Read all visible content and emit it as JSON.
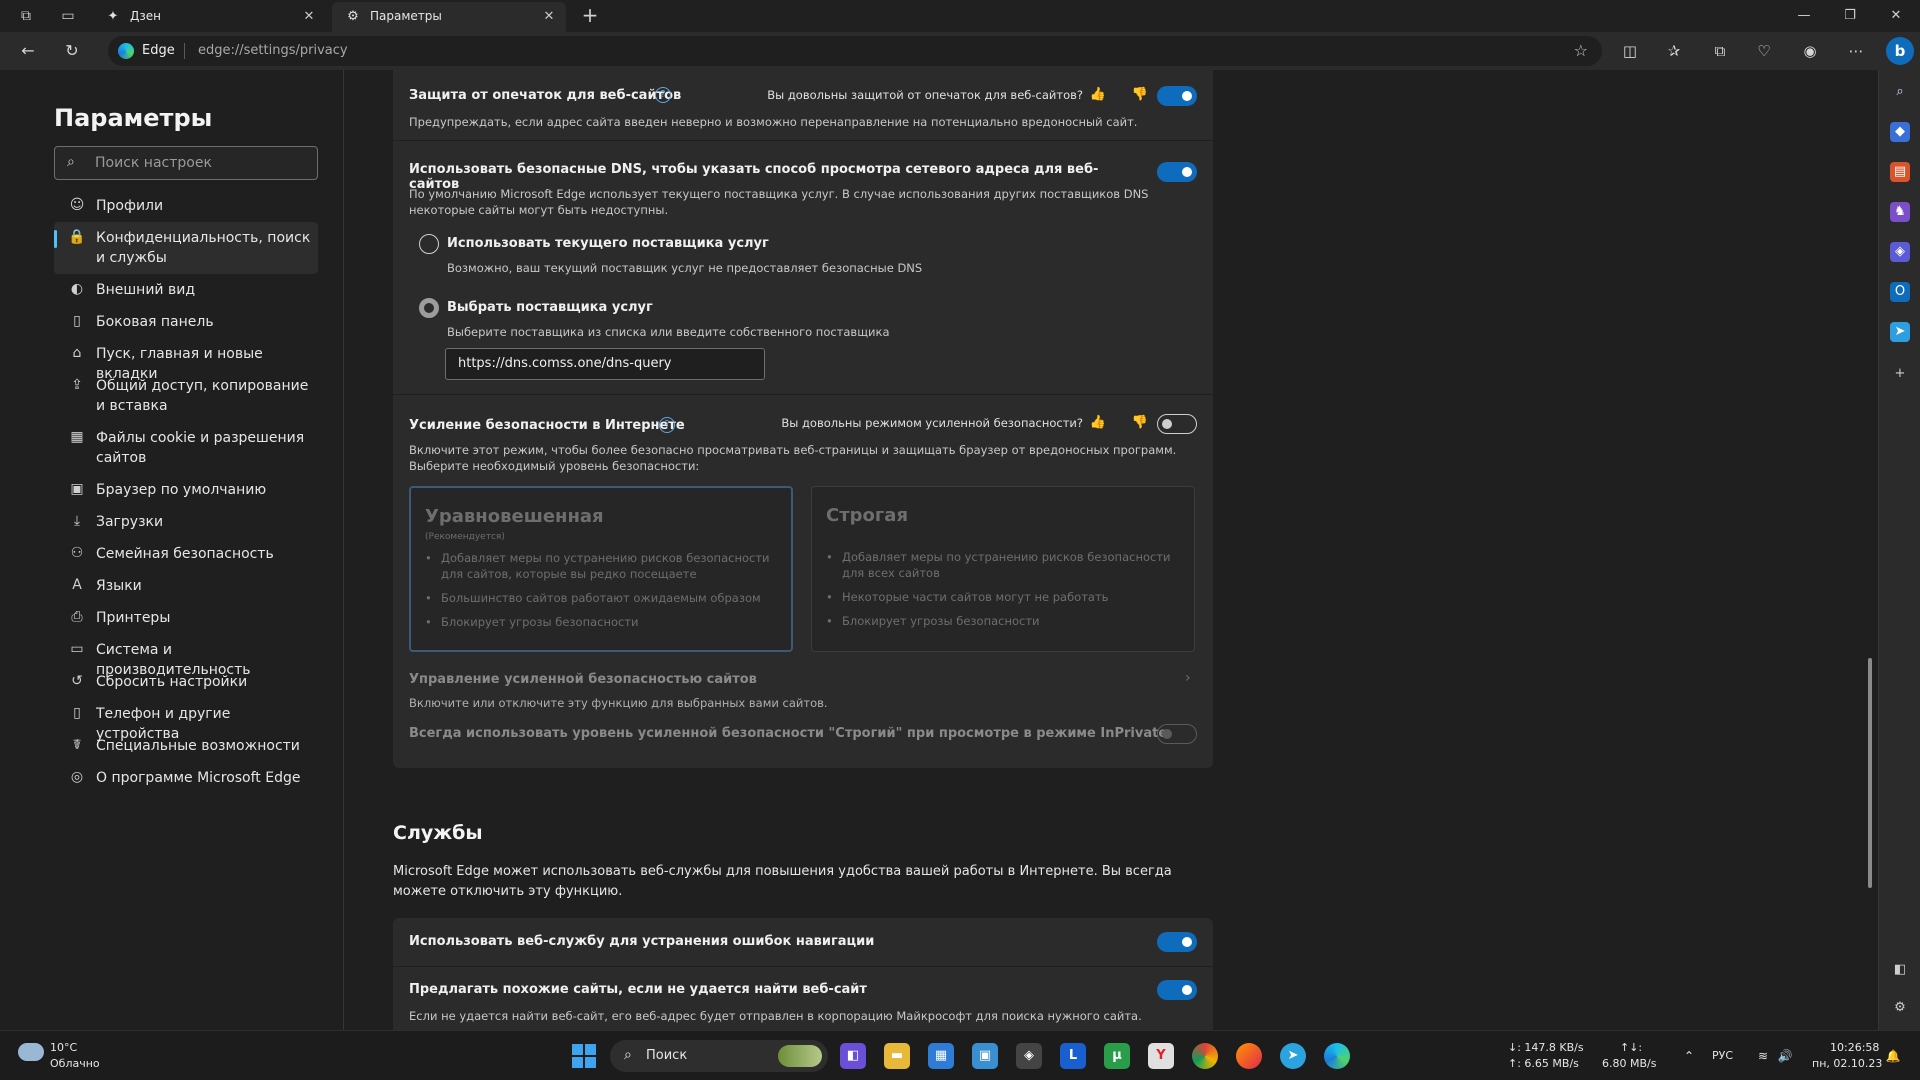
{
  "window": {
    "tabs": [
      {
        "label": "Дзен",
        "icon": "sparkle-icon"
      },
      {
        "label": "Параметры",
        "icon": "gear-icon"
      }
    ]
  },
  "address_bar": {
    "site_label": "Edge",
    "url": "edge://settings/privacy"
  },
  "sidebar": {
    "title": "Параметры",
    "search_placeholder": "Поиск настроек",
    "items": [
      {
        "label": "Профили",
        "icon": "profile-icon"
      },
      {
        "label": "Конфиденциальность, поиск и службы",
        "icon": "lock-icon",
        "active": true
      },
      {
        "label": "Внешний вид",
        "icon": "appearance-icon"
      },
      {
        "label": "Боковая панель",
        "icon": "sidebar-panel-icon"
      },
      {
        "label": "Пуск, главная и новые вкладки",
        "icon": "home-icon"
      },
      {
        "label": "Общий доступ, копирование и вставка",
        "icon": "share-icon"
      },
      {
        "label": "Файлы cookie и разрешения сайтов",
        "icon": "cookie-icon"
      },
      {
        "label": "Браузер по умолчанию",
        "icon": "browser-icon"
      },
      {
        "label": "Загрузки",
        "icon": "download-icon"
      },
      {
        "label": "Семейная безопасность",
        "icon": "family-icon"
      },
      {
        "label": "Языки",
        "icon": "language-icon"
      },
      {
        "label": "Принтеры",
        "icon": "printer-icon"
      },
      {
        "label": "Система и производительность",
        "icon": "system-icon"
      },
      {
        "label": "Сбросить настройки",
        "icon": "reset-icon"
      },
      {
        "label": "Телефон и другие устройства",
        "icon": "phone-icon"
      },
      {
        "label": "Специальные возможности",
        "icon": "accessibility-icon"
      },
      {
        "label": "О программе Microsoft Edge",
        "icon": "edge-icon"
      }
    ]
  },
  "typo": {
    "title": "Защита от опечаток для веб-сайтов",
    "question": "Вы довольны защитой от опечаток для веб-сайтов?",
    "description": "Предупреждать, если адрес сайта введен неверно и возможно перенаправление на потенциально вредоносный сайт.",
    "enabled": true
  },
  "dns": {
    "title": "Использовать безопасные DNS, чтобы указать способ просмотра сетевого адреса для веб-сайтов",
    "description": "По умолчанию Microsoft Edge использует текущего поставщика услуг. В случае использования других поставщиков DNS некоторые сайты могут быть недоступны.",
    "enabled": true,
    "option_current_label": "Использовать текущего поставщика услуг",
    "option_current_desc": "Возможно, ваш текущий поставщик услуг не предоставляет безопасные DNS",
    "option_choose_label": "Выбрать поставщика услуг",
    "option_choose_desc": "Выберите поставщика из списка или введите собственного поставщика",
    "provider_value": "https://dns.comss.one/dns-query"
  },
  "enhanced": {
    "title": "Усиление безопасности в Интернете",
    "question": "Вы довольны режимом усиленной безопасности?",
    "description": "Включите этот режим, чтобы более безопасно просматривать веб-страницы и защищать браузер от вредоносных программ. Выберите необходимый уровень безопасности:",
    "enabled": false,
    "balanced": {
      "title": "Уравновешенная",
      "subtitle": "(Рекомендуется)",
      "bullets": [
        "Добавляет меры по устранению рисков безопасности для сайтов, которые вы редко посещаете",
        "Большинство сайтов работают ожидаемым образом",
        "Блокирует угрозы безопасности"
      ]
    },
    "strict": {
      "title": "Строгая",
      "bullets": [
        "Добавляет меры по устранению рисков безопасности для всех сайтов",
        "Некоторые части сайтов могут не работать",
        "Блокирует угрозы безопасности"
      ]
    },
    "manage_title": "Управление усиленной безопасностью сайтов",
    "manage_desc": "Включите или отключите эту функцию для выбранных вами сайтов.",
    "inprivate_label": "Всегда использовать уровень усиленной безопасности \"Строгий\" при просмотре в режиме InPrivate"
  },
  "services": {
    "title": "Службы",
    "description": "Microsoft Edge может использовать веб-службы для повышения удобства вашей работы в Интернете. Вы всегда можете отключить эту функцию.",
    "nav_errors_label": "Использовать веб-службу для устранения ошибок навигации",
    "nav_errors_enabled": true,
    "similar_label": "Предлагать похожие сайты, если не удается найти веб-сайт",
    "similar_enabled": true,
    "similar_desc": "Если не удается найти веб-сайт, его веб-адрес будет отправлен в корпорацию Майкрософт для поиска нужного сайта."
  },
  "taskbar": {
    "weather_temp": "10°C",
    "weather_condition": "Облачно",
    "search_label": "Поиск",
    "net_down": "↓: 147.8 KB/s",
    "net_up": "↑: 6.65 MB/s",
    "net_total_label": "↑↓:",
    "net_total": "6.80 MB/s",
    "language": "РУС",
    "time": "10:26:58",
    "date": "пн, 02.10.23"
  },
  "colors": {
    "accent": "#0f6cbd",
    "active_indicator": "#4cc2ff"
  }
}
